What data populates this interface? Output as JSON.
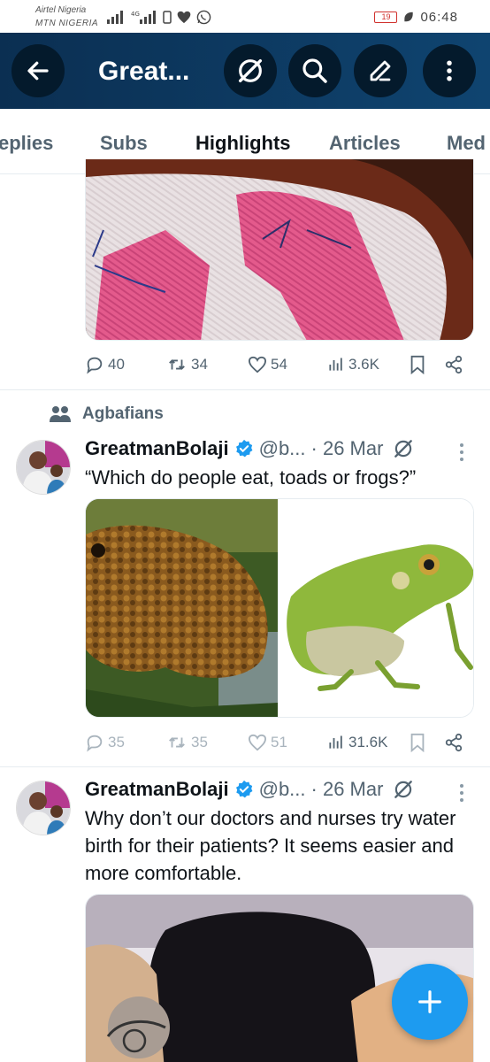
{
  "status_bar": {
    "carrier1": "Airtel Nigeria",
    "carrier2": "MTN NIGERIA",
    "battery": "19",
    "time": "06:48"
  },
  "header": {
    "title": "Great...",
    "icons": [
      "back-arrow-icon",
      "grok-icon",
      "search-icon",
      "edit-icon",
      "more-vertical-icon"
    ]
  },
  "tabs": [
    {
      "label": "eplies"
    },
    {
      "label": "Subs"
    },
    {
      "label": "Highlights",
      "active": true
    },
    {
      "label": "Articles"
    },
    {
      "label": "Med"
    }
  ],
  "posts": [
    {
      "stats": {
        "replies": "40",
        "reposts": "34",
        "likes": "54",
        "views": "3.6K"
      }
    },
    {
      "community": "Agbafians",
      "author": "GreatmanBolaji",
      "handle": "@b...",
      "date": "· 26 Mar",
      "text": "“Which do people eat, toads or frogs?”",
      "stats": {
        "replies": "35",
        "reposts": "35",
        "likes": "51",
        "views": "31.6K"
      }
    },
    {
      "author": "GreatmanBolaji",
      "handle": "@b...",
      "date": "· 26 Mar",
      "text": "Why don’t our doctors and nurses try water birth for their patients? It seems easier and more comfortable."
    }
  ],
  "colors": {
    "accent": "#1d9bf0",
    "header_bg": "#0d3b66",
    "verified": "#1d9bf0"
  },
  "fab": {
    "icon": "plus-icon"
  }
}
